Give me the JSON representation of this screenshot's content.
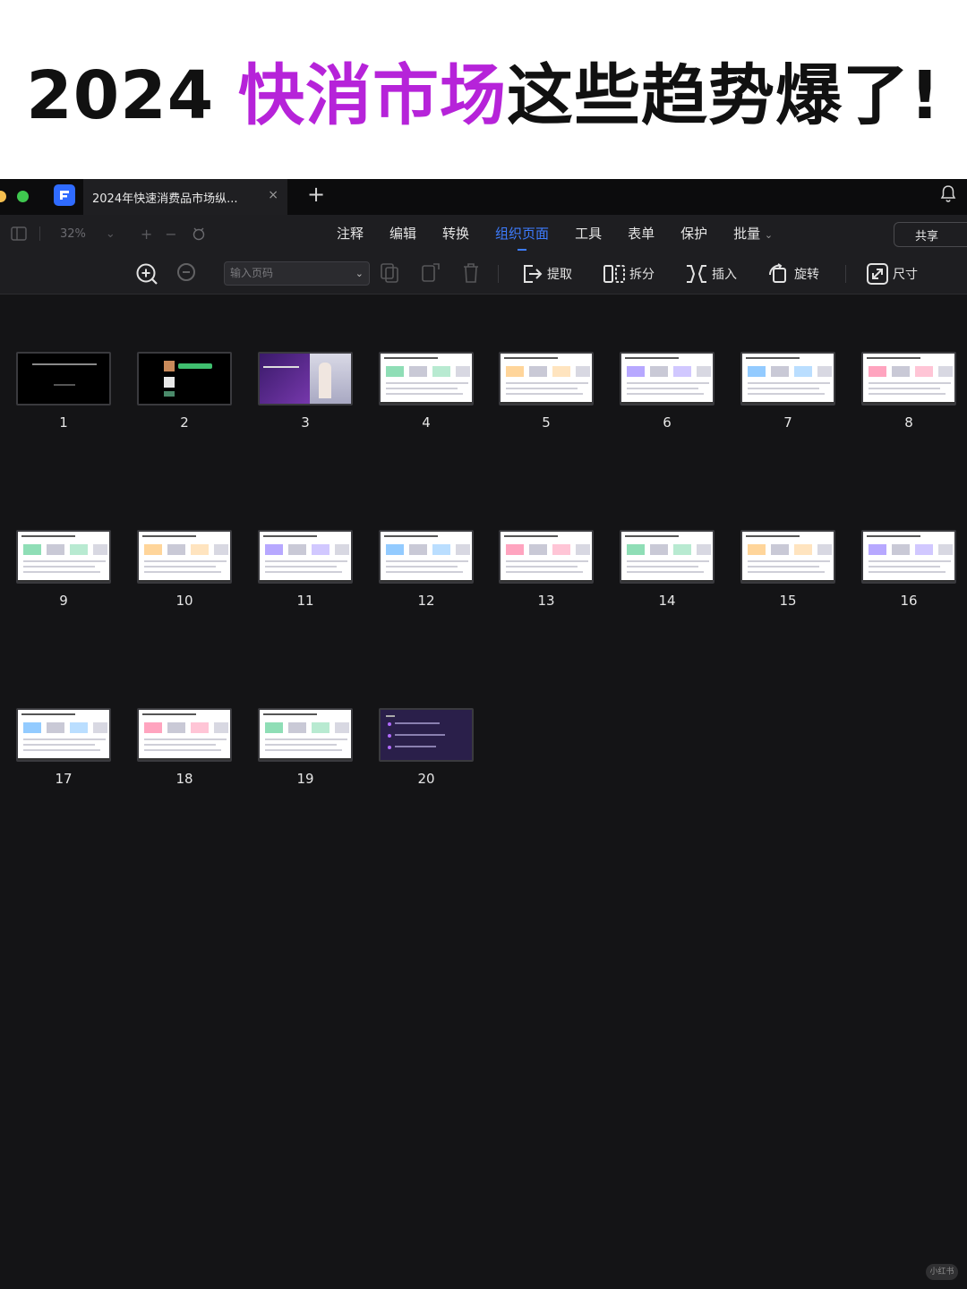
{
  "headline": {
    "prefix": "2024 ",
    "accent": "快消市场",
    "suffix": "这些趋势爆了!"
  },
  "titlebar": {
    "document_tab": "2024年快速消费品市场纵...",
    "close_glyph": "×",
    "new_tab_glyph": "+"
  },
  "toolbar": {
    "zoom_value": "32%",
    "menu": [
      "注释",
      "编辑",
      "转换",
      "组织页面",
      "工具",
      "表单",
      "保护",
      "批量"
    ],
    "active_menu": "组织页面",
    "share_label": "共享"
  },
  "subtoolbar": {
    "page_input_placeholder": "输入页码",
    "tools": {
      "extract": "提取",
      "split": "拆分",
      "insert": "插入",
      "rotate": "旋转",
      "size": "尺寸"
    }
  },
  "pages": [
    {
      "number": "1",
      "style": "dark"
    },
    {
      "number": "2",
      "style": "dark"
    },
    {
      "number": "3",
      "style": "photo"
    },
    {
      "number": "4",
      "style": "light"
    },
    {
      "number": "5",
      "style": "light"
    },
    {
      "number": "6",
      "style": "light"
    },
    {
      "number": "7",
      "style": "light"
    },
    {
      "number": "8",
      "style": "light"
    },
    {
      "number": "9",
      "style": "light"
    },
    {
      "number": "10",
      "style": "light"
    },
    {
      "number": "11",
      "style": "light"
    },
    {
      "number": "12",
      "style": "light"
    },
    {
      "number": "13",
      "style": "light"
    },
    {
      "number": "14",
      "style": "light"
    },
    {
      "number": "15",
      "style": "light"
    },
    {
      "number": "16",
      "style": "light"
    },
    {
      "number": "17",
      "style": "light"
    },
    {
      "number": "18",
      "style": "light"
    },
    {
      "number": "19",
      "style": "light"
    },
    {
      "number": "20",
      "style": "purple"
    }
  ],
  "watermark": "小红书",
  "colors": {
    "accent_purple": "#b623d9",
    "active_blue": "#3d7cff",
    "app_bg": "#141416"
  }
}
